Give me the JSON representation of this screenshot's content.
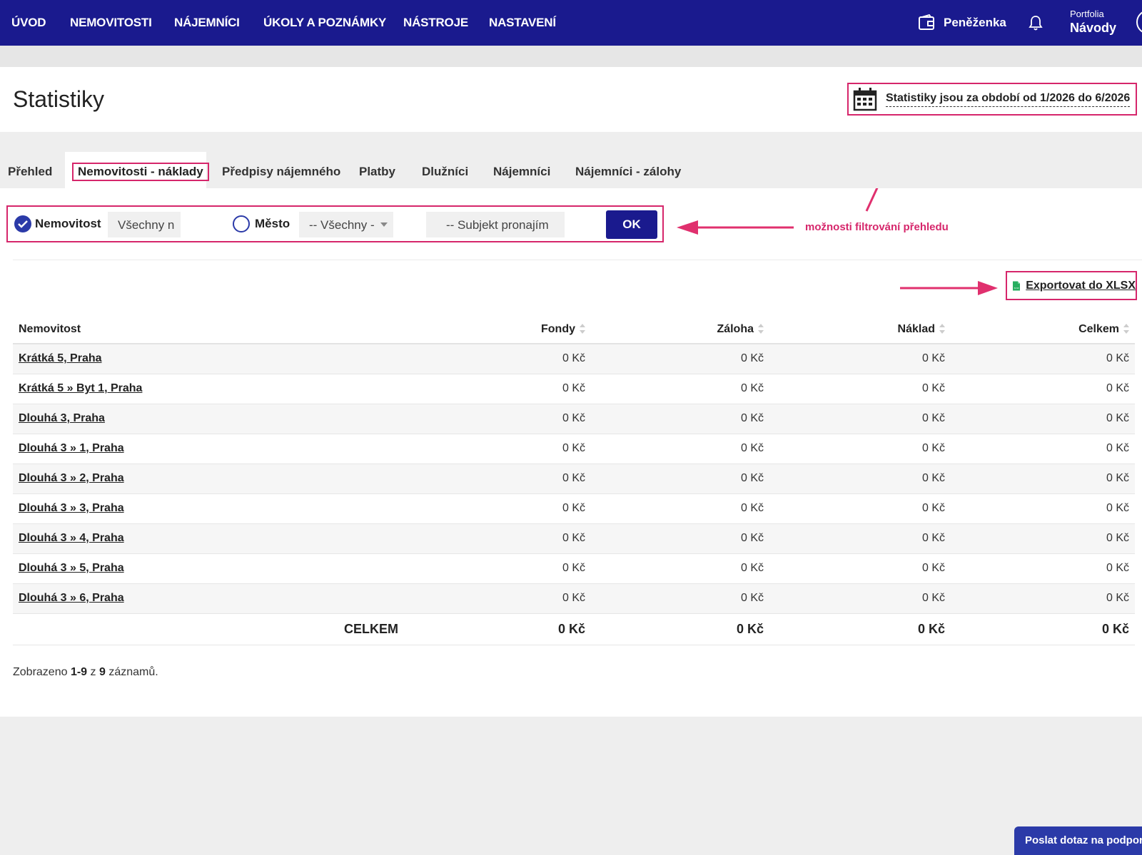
{
  "nav": {
    "items": [
      "ÚVOD",
      "NEMOVITOSTI",
      "NÁJEMNÍCI",
      "ÚKOLY A POZNÁMKY",
      "NÁSTROJE",
      "NASTAVENÍ"
    ],
    "wallet_label": "Peněženka",
    "wallet_icon": "wallet-icon",
    "bell_icon": "bell-icon",
    "portfolio_label": "Portfolia",
    "portfolio_value": "Návody"
  },
  "header": {
    "title": "Statistiky",
    "period_text": "Statistiky jsou za období od 1/2026 do 6/2026",
    "calendar_icon": "calendar-icon"
  },
  "tabs": [
    "Přehled",
    "Nemovitosti - náklady",
    "Předpisy nájemného",
    "Platby",
    "Dlužníci",
    "Nájemníci",
    "Nájemníci - zálohy"
  ],
  "active_tab": "Nemovitosti - náklady",
  "filter": {
    "radio1_label": "Nemovitost",
    "input1_value": "Všechny n",
    "radio2_label": "Město",
    "select_value": "-- Všechny -",
    "subject_placeholder": "-- Subjekt pronajím",
    "ok_label": "OK"
  },
  "annotation": "možnosti filtrování přehledu",
  "export": {
    "label": "Exportovat do XLSX",
    "icon": "xlsx-file-icon",
    "icon_text": "XLSX"
  },
  "table": {
    "columns": [
      "Nemovitost",
      "Fondy",
      "Záloha",
      "Náklad",
      "Celkem"
    ],
    "rows": [
      {
        "name": "Krátká 5, Praha",
        "fondy": "0 Kč",
        "zaloha": "0 Kč",
        "naklad": "0 Kč",
        "celkem": "0 Kč"
      },
      {
        "name": "Krátká 5 » Byt 1, Praha",
        "fondy": "0 Kč",
        "zaloha": "0 Kč",
        "naklad": "0 Kč",
        "celkem": "0 Kč"
      },
      {
        "name": "Dlouhá 3, Praha",
        "fondy": "0 Kč",
        "zaloha": "0 Kč",
        "naklad": "0 Kč",
        "celkem": "0 Kč"
      },
      {
        "name": "Dlouhá 3 » 1, Praha",
        "fondy": "0 Kč",
        "zaloha": "0 Kč",
        "naklad": "0 Kč",
        "celkem": "0 Kč"
      },
      {
        "name": "Dlouhá 3 » 2, Praha",
        "fondy": "0 Kč",
        "zaloha": "0 Kč",
        "naklad": "0 Kč",
        "celkem": "0 Kč"
      },
      {
        "name": "Dlouhá 3 » 3, Praha",
        "fondy": "0 Kč",
        "zaloha": "0 Kč",
        "naklad": "0 Kč",
        "celkem": "0 Kč"
      },
      {
        "name": "Dlouhá 3 » 4, Praha",
        "fondy": "0 Kč",
        "zaloha": "0 Kč",
        "naklad": "0 Kč",
        "celkem": "0 Kč"
      },
      {
        "name": "Dlouhá 3 » 5, Praha",
        "fondy": "0 Kč",
        "zaloha": "0 Kč",
        "naklad": "0 Kč",
        "celkem": "0 Kč"
      },
      {
        "name": "Dlouhá 3 » 6, Praha",
        "fondy": "0 Kč",
        "zaloha": "0 Kč",
        "naklad": "0 Kč",
        "celkem": "0 Kč"
      }
    ],
    "total": {
      "label": "CELKEM",
      "fondy": "0 Kč",
      "zaloha": "0 Kč",
      "naklad": "0 Kč",
      "celkem": "0 Kč"
    }
  },
  "summary": {
    "prefix": "Zobrazeno",
    "range": "1-9",
    "middle": "z",
    "count": "9",
    "suffix": "záznamů."
  },
  "support_label": "Poslat dotaz na podporu",
  "colors": {
    "nav_bg": "#1a1a8e",
    "accent": "#2b3aa8",
    "highlight": "#d6266b"
  }
}
